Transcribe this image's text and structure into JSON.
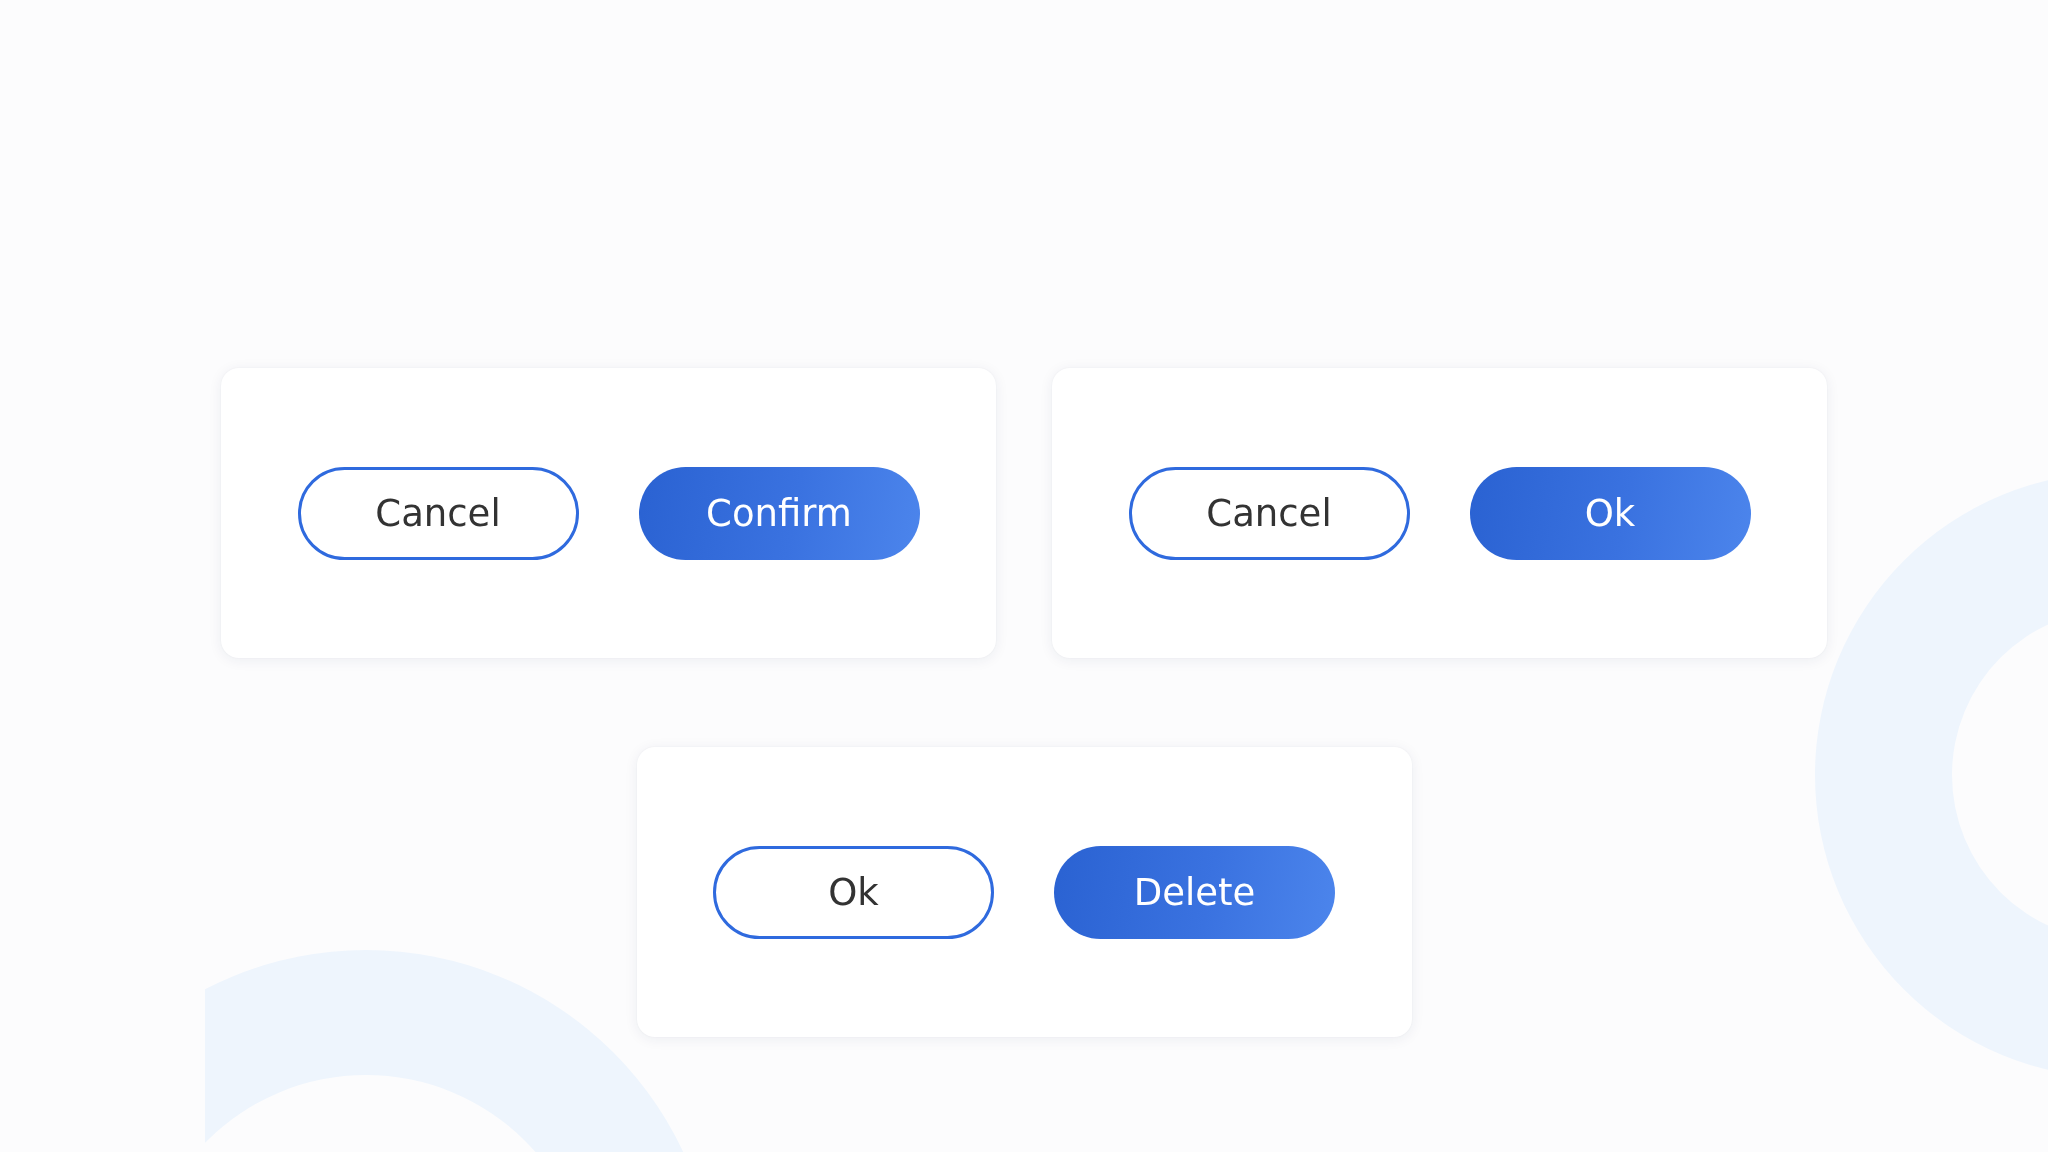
{
  "cards": [
    {
      "buttons": [
        {
          "label": "Cancel",
          "kind": "outline"
        },
        {
          "label": "Confirm",
          "kind": "filled"
        }
      ]
    },
    {
      "buttons": [
        {
          "label": "Cancel",
          "kind": "outline"
        },
        {
          "label": "Ok",
          "kind": "filled"
        }
      ]
    },
    {
      "buttons": [
        {
          "label": "Ok",
          "kind": "outline"
        },
        {
          "label": "Delete",
          "kind": "filled"
        }
      ]
    }
  ]
}
